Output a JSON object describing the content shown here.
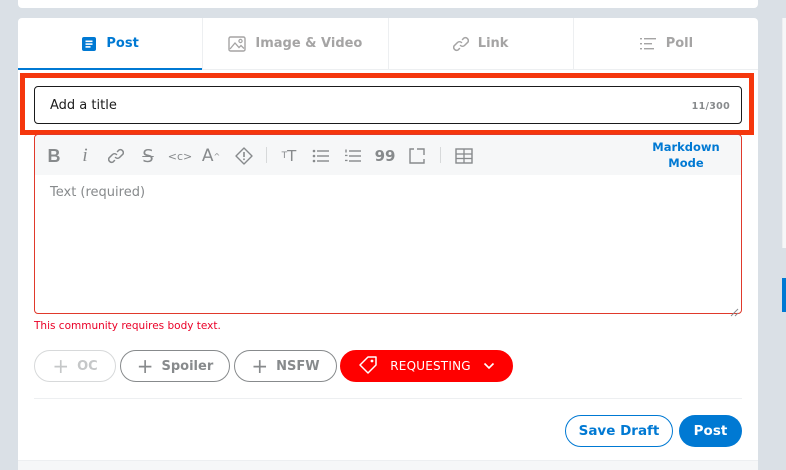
{
  "tabs": [
    {
      "label": "Post",
      "icon": "post-icon",
      "active": true
    },
    {
      "label": "Image & Video",
      "icon": "image-icon",
      "active": false
    },
    {
      "label": "Link",
      "icon": "link-icon",
      "active": false
    },
    {
      "label": "Poll",
      "icon": "poll-icon",
      "active": false
    }
  ],
  "title_field": {
    "placeholder": "Add a title",
    "counter": "11/300"
  },
  "toolbar": {
    "icons": [
      "bold-icon",
      "italic-icon",
      "link-icon",
      "strikethrough-icon",
      "inline-code-icon",
      "superscript-icon",
      "spoiler-icon",
      "heading-icon",
      "bulleted-list-icon",
      "numbered-list-icon",
      "quote-block-icon",
      "code-block-icon",
      "table-icon"
    ],
    "markdown_mode": "Markdown Mode"
  },
  "body_field": {
    "placeholder": "Text (required)"
  },
  "error": "This community requires body text.",
  "flair": {
    "oc": "OC",
    "spoiler": "Spoiler",
    "nsfw": "NSFW",
    "requesting": "REQUESTING"
  },
  "actions": {
    "save_draft": "Save Draft",
    "post": "Post"
  },
  "colors": {
    "accent": "#0079d3",
    "highlight": "#f5370d",
    "error": "#ea0027",
    "flair_bg": "#ff0000"
  }
}
